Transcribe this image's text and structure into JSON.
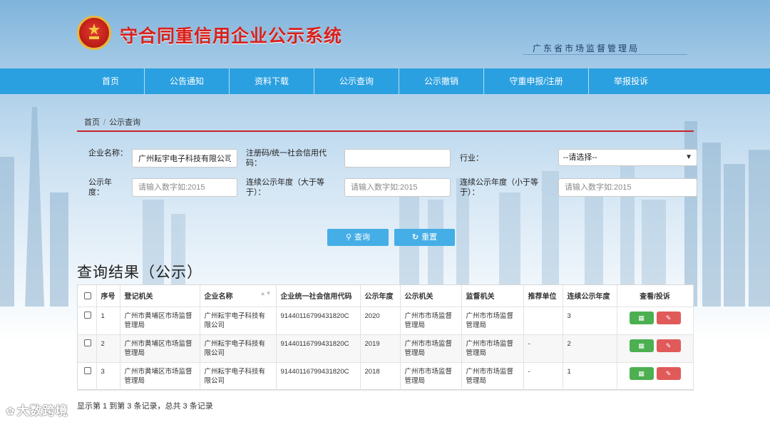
{
  "header": {
    "title": "守合同重信用企业公示系统",
    "org": "广东省市场监督管理局"
  },
  "nav": {
    "items": [
      {
        "label": "首页"
      },
      {
        "label": "公告通知"
      },
      {
        "label": "资料下载"
      },
      {
        "label": "公示查询"
      },
      {
        "label": "公示撤销"
      },
      {
        "label": "守重申报/注册"
      },
      {
        "label": "举报投诉"
      }
    ]
  },
  "breadcrumb": {
    "home": "首页",
    "sep": "/",
    "current": "公示查询"
  },
  "form": {
    "company_label": "企业名称：",
    "company_value": "广州耘宇电子科技有限公司",
    "code_label": "注册码/统一社会信用代码：",
    "code_value": "",
    "industry_label": "行业：",
    "industry_selected": "--请选择--",
    "year_label": "公示年度：",
    "year_placeholder": "请输入数字如:2015",
    "year_gte_label": "连续公示年度（大于等于）：",
    "year_gte_placeholder": "请输入数字如:2015",
    "year_lte_label": "连续公示年度（小于等于）：",
    "year_lte_placeholder": "请输入数字如:2015",
    "search_btn": "查询",
    "reset_btn": "重置"
  },
  "results": {
    "title": "查询结果（公示）",
    "columns": [
      "序号",
      "登记机关",
      "企业名称",
      "企业统一社会信用代码",
      "公示年度",
      "公示机关",
      "监督机关",
      "推荐单位",
      "连续公示年度",
      "查看/投诉"
    ],
    "rows": [
      {
        "no": "1",
        "reg": "广州市黄埔区市场监督管理局",
        "name": "广州耘宇电子科技有限公司",
        "code": "91440116799431820C",
        "year": "2020",
        "pub": "广州市市场监督管理局",
        "sup": "广州市市场监督管理局",
        "rec": "",
        "cont": "3"
      },
      {
        "no": "2",
        "reg": "广州市黄埔区市场监督管理局",
        "name": "广州耘宇电子科技有限公司",
        "code": "91440116799431820C",
        "year": "2019",
        "pub": "广州市市场监督管理局",
        "sup": "广州市市场监督管理局",
        "rec": "-",
        "cont": "2"
      },
      {
        "no": "3",
        "reg": "广州市黄埔区市场监督管理局",
        "name": "广州耘宇电子科技有限公司",
        "code": "91440116799431820C",
        "year": "2018",
        "pub": "广州市市场监督管理局",
        "sup": "广州市市场监督管理局",
        "rec": "-",
        "cont": "1"
      }
    ],
    "summary": "显示第 1 到第 3 条记录，总共 3 条记录"
  },
  "watermark": "大数跨境",
  "colors": {
    "nav": "#2ba0e0",
    "accent_red": "#c8242b",
    "button": "#45aee6",
    "view": "#4caf50",
    "complain": "#e05a5a"
  }
}
